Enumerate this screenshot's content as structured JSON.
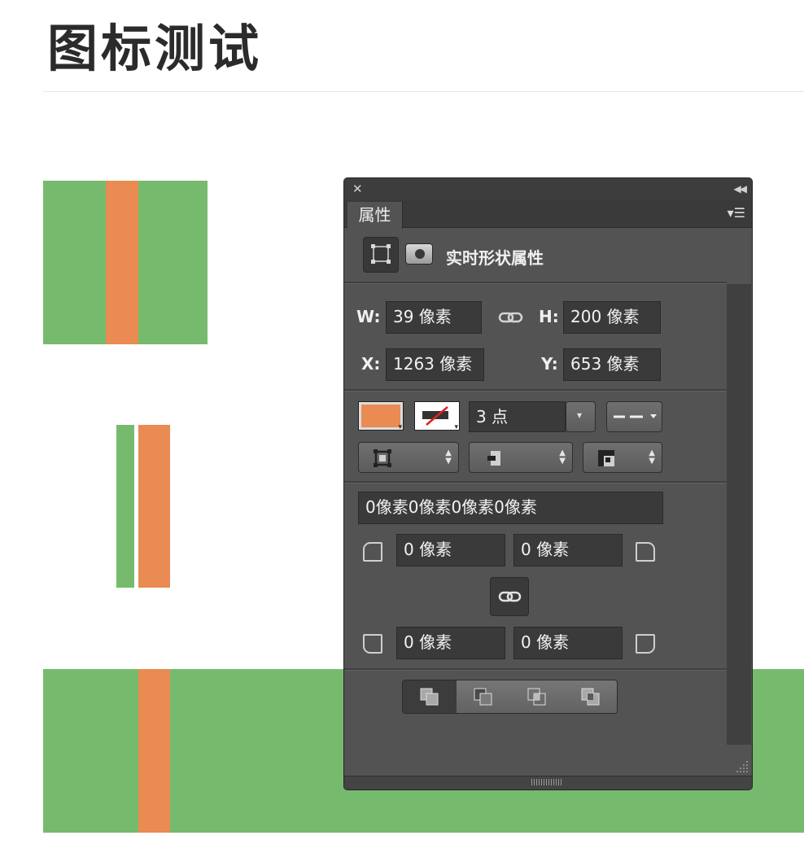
{
  "page": {
    "title": "图标测试"
  },
  "colors": {
    "green": "#76bb6d",
    "orange": "#e98b52",
    "panel_bg": "#535353"
  },
  "panel": {
    "tab_label": "属性",
    "close_icon": "close-icon",
    "collapse_icon": "double-chevron-left-icon",
    "menu_icon": "panel-menu-icon",
    "header_label": "实时形状属性",
    "w_label": "W:",
    "w_value": "39 像素",
    "h_label": "H:",
    "h_value": "200 像素",
    "x_label": "X:",
    "x_value": "1263 像素",
    "y_label": "Y:",
    "y_value": "653 像素",
    "stroke_width": "3 点",
    "radius_summary": "0像素0像素0像素0像素",
    "radius_tl": "0 像素",
    "radius_tr": "0 像素",
    "radius_bl": "0 像素",
    "radius_br": "0 像素"
  }
}
